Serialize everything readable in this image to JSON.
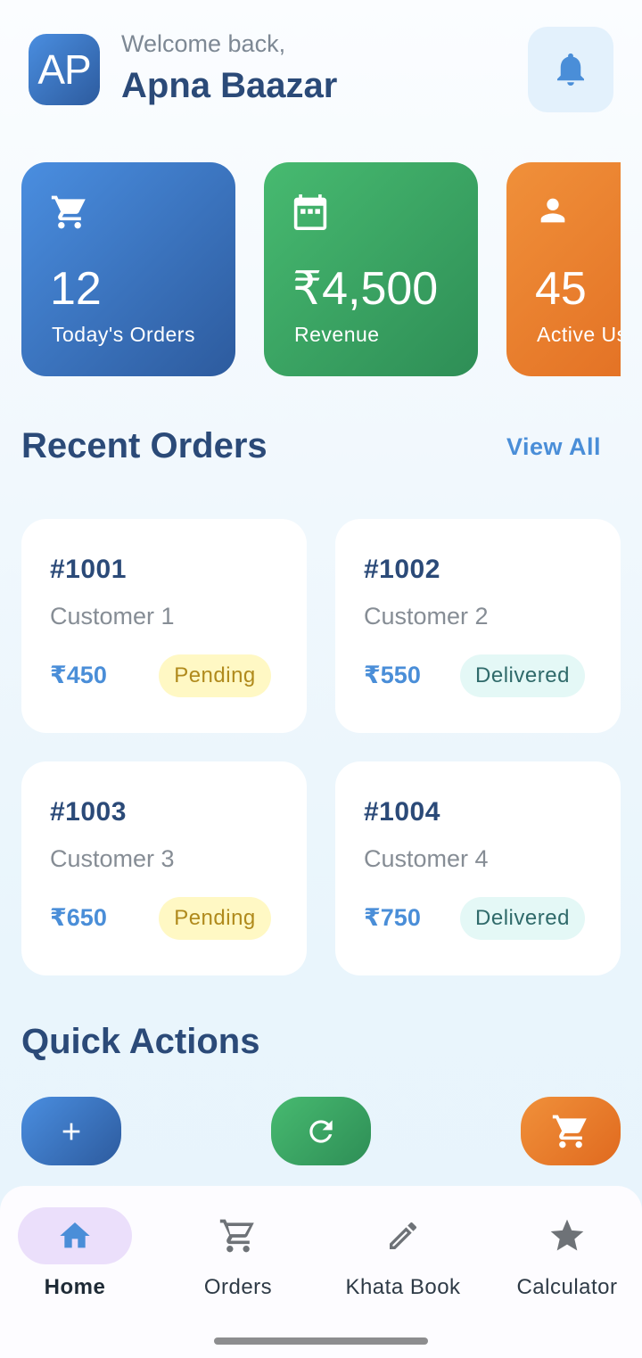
{
  "header": {
    "logo_text": "AP",
    "welcome": "Welcome back,",
    "shop_name": "Apna Baazar",
    "notification_icon": "bell-icon"
  },
  "stats": [
    {
      "icon": "cart-icon",
      "value": "12",
      "label": "Today's Orders",
      "color": "#3a6fb8"
    },
    {
      "icon": "calendar-icon",
      "value": "₹4,500",
      "label": "Revenue",
      "color": "#3aa362"
    },
    {
      "icon": "person-icon",
      "value": "45",
      "label": "Active Users",
      "color": "#e97d2c"
    }
  ],
  "recent_orders": {
    "title": "Recent Orders",
    "view_all": "View All",
    "orders": [
      {
        "id": "#1001",
        "customer": "Customer 1",
        "amount": "₹450",
        "status": "Pending"
      },
      {
        "id": "#1002",
        "customer": "Customer 2",
        "amount": "₹550",
        "status": "Delivered"
      },
      {
        "id": "#1003",
        "customer": "Customer 3",
        "amount": "₹650",
        "status": "Pending"
      },
      {
        "id": "#1004",
        "customer": "Customer 4",
        "amount": "₹750",
        "status": "Delivered"
      }
    ]
  },
  "quick_actions": {
    "title": "Quick Actions",
    "actions": [
      {
        "icon": "plus-icon",
        "color": "#3a6fb8"
      },
      {
        "icon": "refresh-icon",
        "color": "#3aa362"
      },
      {
        "icon": "cart-icon",
        "color": "#e97d2c"
      }
    ]
  },
  "bottom_nav": {
    "items": [
      {
        "label": "Home",
        "icon": "home-icon",
        "active": true
      },
      {
        "label": "Orders",
        "icon": "cart-icon",
        "active": false
      },
      {
        "label": "Khata Book",
        "icon": "pencil-icon",
        "active": false
      },
      {
        "label": "Calculator",
        "icon": "star-icon",
        "active": false
      }
    ]
  },
  "colors": {
    "primary": "#2b4a78",
    "accent": "#4a8ed8",
    "pending_bg": "#fff8c4",
    "delivered_bg": "#e4f8f6",
    "nav_active": "#ebdffb"
  }
}
